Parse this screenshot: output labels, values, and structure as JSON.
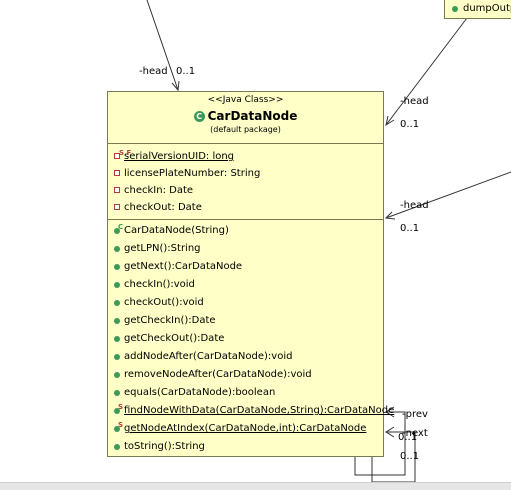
{
  "class": {
    "stereotype": "<<Java Class>>",
    "name": "CarDataNode",
    "icon": "class-c-icon",
    "package": "(default package)",
    "fields": [
      {
        "text": "serialVersionUID: long",
        "visibility": "private",
        "modifiers": "S F",
        "underline": true
      },
      {
        "text": "licensePlateNumber: String",
        "visibility": "private",
        "modifiers": "",
        "underline": false
      },
      {
        "text": "checkIn: Date",
        "visibility": "private",
        "modifiers": "",
        "underline": false
      },
      {
        "text": "checkOut: Date",
        "visibility": "private",
        "modifiers": "",
        "underline": false
      }
    ],
    "methods": [
      {
        "text": "CarDataNode(String)",
        "visibility": "public",
        "modifiers": "C",
        "underline": false
      },
      {
        "text": "getLPN():String",
        "visibility": "public",
        "modifiers": "",
        "underline": false
      },
      {
        "text": "getNext():CarDataNode",
        "visibility": "public",
        "modifiers": "",
        "underline": false
      },
      {
        "text": "checkIn():void",
        "visibility": "public",
        "modifiers": "",
        "underline": false
      },
      {
        "text": "checkOut():void",
        "visibility": "public",
        "modifiers": "",
        "underline": false
      },
      {
        "text": "getCheckIn():Date",
        "visibility": "public",
        "modifiers": "",
        "underline": false
      },
      {
        "text": "getCheckOut():Date",
        "visibility": "public",
        "modifiers": "",
        "underline": false
      },
      {
        "text": "addNodeAfter(CarDataNode):void",
        "visibility": "public",
        "modifiers": "",
        "underline": false
      },
      {
        "text": "removeNodeAfter(CarDataNode):void",
        "visibility": "public",
        "modifiers": "",
        "underline": false
      },
      {
        "text": "equals(CarDataNode):boolean",
        "visibility": "public",
        "modifiers": "",
        "underline": false
      },
      {
        "text": "findNodeWithData(CarDataNode,String):CarDataNode",
        "visibility": "public",
        "modifiers": "S",
        "underline": true
      },
      {
        "text": "getNodeAtIndex(CarDataNode,int):CarDataNode",
        "visibility": "public",
        "modifiers": "S",
        "underline": true
      },
      {
        "text": "toString():String",
        "visibility": "public",
        "modifiers": "",
        "underline": false
      }
    ]
  },
  "peer_class": {
    "method": "dumpOutp"
  },
  "associations": {
    "top_role": "-head",
    "top_mult": "0..1",
    "right1_role": "-head",
    "right1_mult": "0..1",
    "right2_role": "-head",
    "right2_mult": "0..1",
    "self_prev_role": "-prev",
    "self_prev_mult": "0..1",
    "self_next_role": "-next",
    "self_next_mult": "0..1"
  },
  "colors": {
    "class_fill": "#ffffc8",
    "border": "#7a7a52",
    "public_icon": "#3c9a58",
    "private_icon": "#b23c3c"
  }
}
